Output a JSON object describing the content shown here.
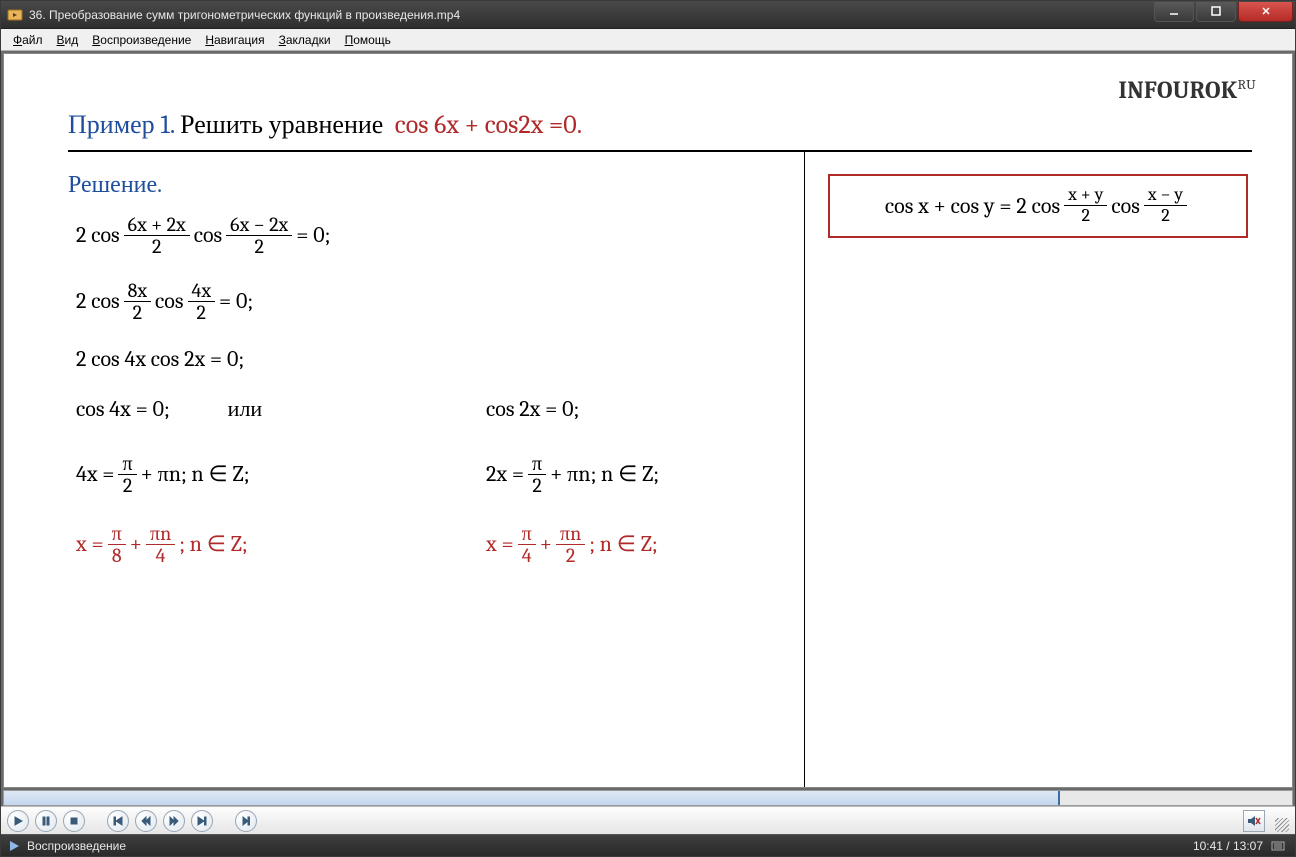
{
  "window": {
    "title": "36. Преобразование сумм тригонометрических функций в произведения.mp4"
  },
  "menu": {
    "items": [
      {
        "text": "Файл",
        "hot": "Ф"
      },
      {
        "text": "Вид",
        "hot": "В"
      },
      {
        "text": "Воспроизведение",
        "hot": "В"
      },
      {
        "text": "Навигация",
        "hot": "Н"
      },
      {
        "text": "Закладки",
        "hot": "З"
      },
      {
        "text": "Помощь",
        "hot": "П"
      }
    ]
  },
  "brand": "INFOUROK",
  "brand_suffix": "RU",
  "problem": {
    "label": "Пример 1.",
    "task": "Решить уравнение",
    "equation": "cos 6x + cos2x =0."
  },
  "solution_title": "Решение.",
  "steps": {
    "s1a": "2 cos",
    "s1_num1": "6x + 2x",
    "s1_den": "2",
    "s1b": "cos",
    "s1_num2": "6x − 2x",
    "s1_tail": " = 0;",
    "s2a": "2 cos",
    "s2_num1": "8x",
    "s2_den": "2",
    "s2b": "cos",
    "s2_num2": "4x",
    "s2_tail": " = 0;",
    "s3": "2 cos 4x cos 2x = 0;",
    "s4_left": "cos 4x = 0;",
    "s4_mid": "или",
    "s4_right": "cos 2x = 0;",
    "s5_l_pre": "4x = ",
    "s5_pi": "π",
    "s5_two": "2",
    "s5_l_post": " + πn; n ∈ Z;",
    "s5_r_pre": "2x = ",
    "s5_r_post": " + πn; n ∈ Z;",
    "s6_l_pre": "x = ",
    "s6_l_f1n": "π",
    "s6_l_f1d": "8",
    "s6_plus": " + ",
    "s6_l_f2n": "πn",
    "s6_l_f2d": "4",
    "s6_tail": " ; n ∈ Z;",
    "s6_r_f1d": "4",
    "s6_r_f2d": "2"
  },
  "formula": {
    "lhs": "cos x + cos y = 2 cos",
    "f1n": "x + y",
    "f1d": "2",
    "mid": "cos",
    "f2n": "x − y",
    "f2d": "2"
  },
  "player": {
    "status": "Воспроизведение",
    "time": "10:41 / 13:07"
  }
}
